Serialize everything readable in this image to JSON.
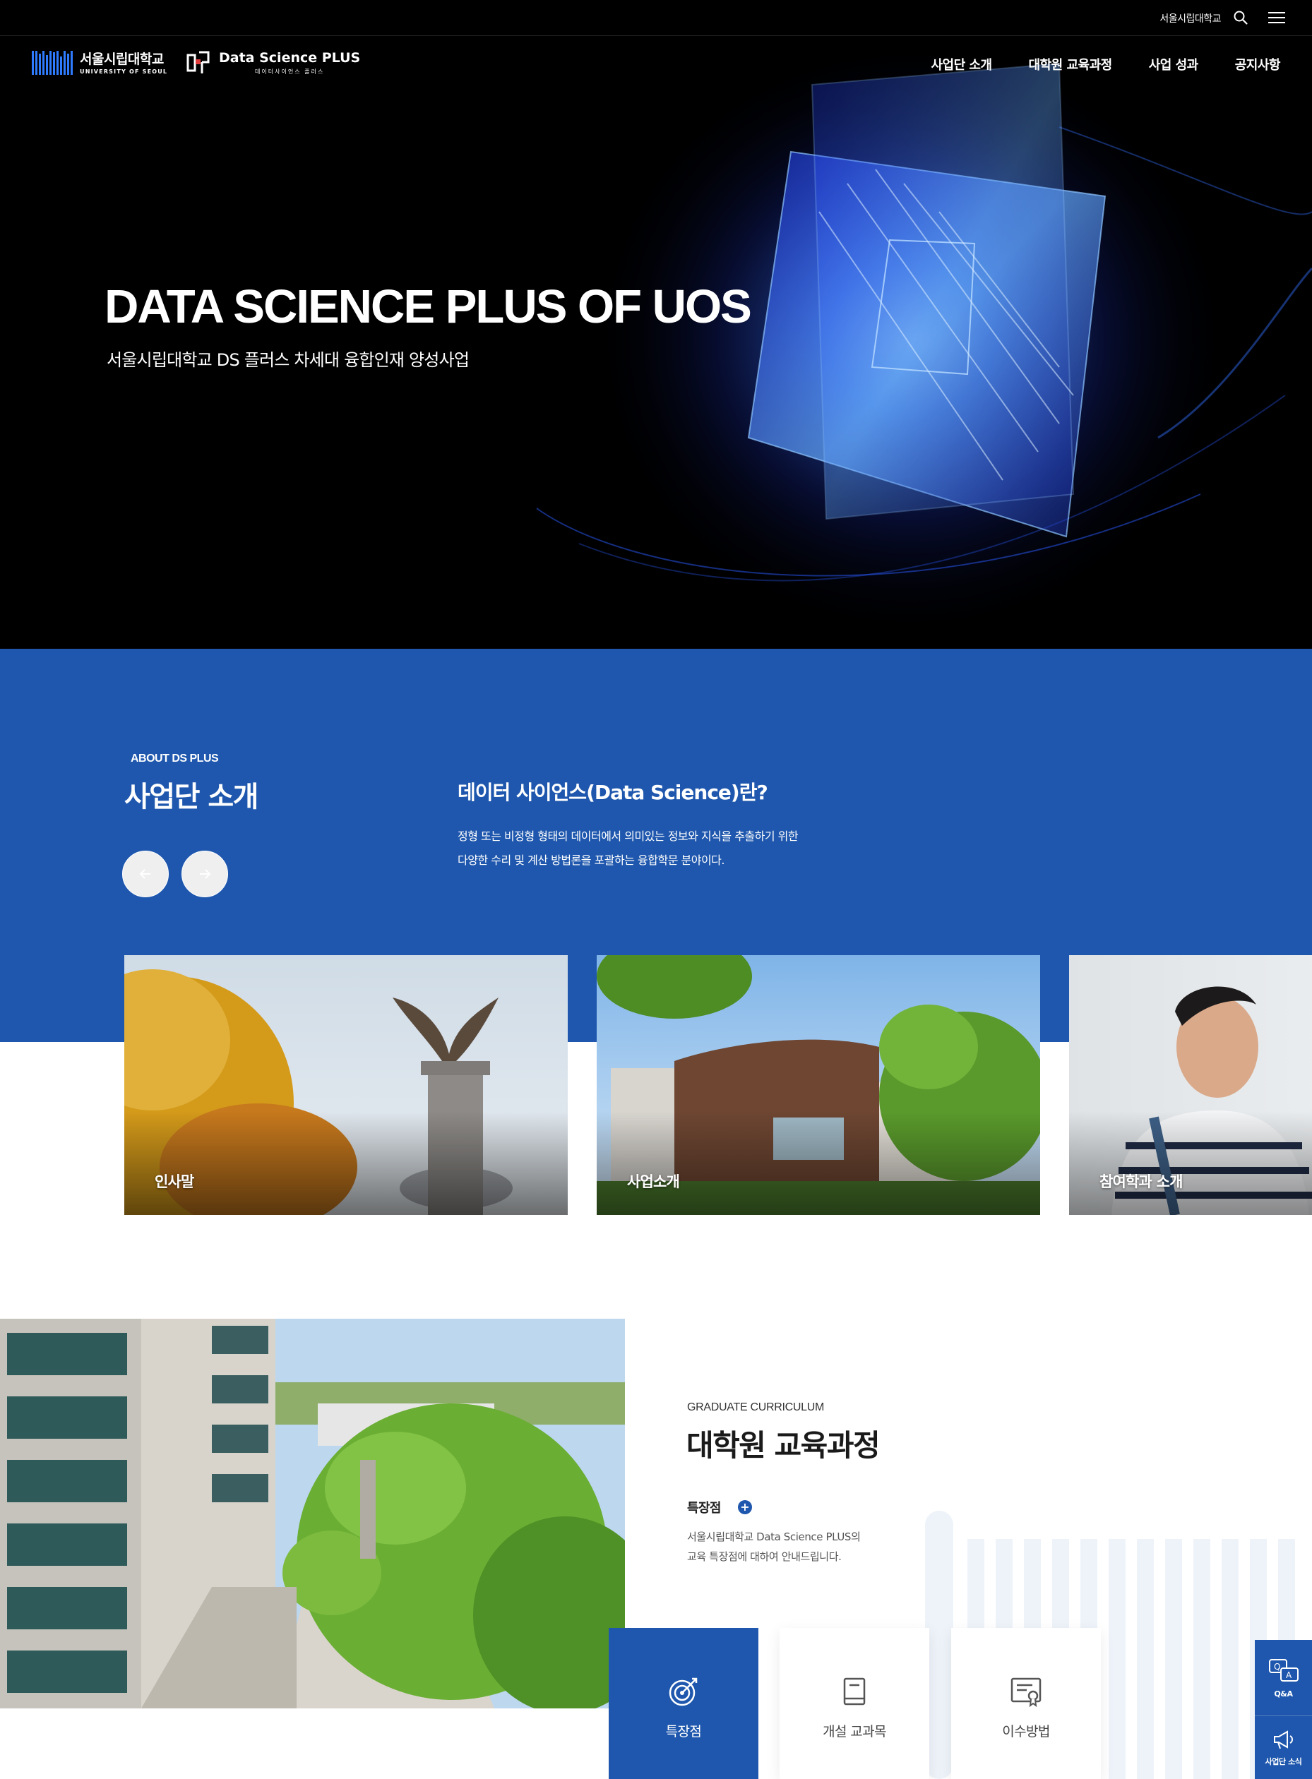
{
  "topbar": {
    "university_link": "서울시립대학교"
  },
  "logos": {
    "uos_korean": "서울시립대학교",
    "uos_english": "UNIVERSITY OF SEOUL",
    "ds_title": "Data Science PLUS",
    "ds_subtitle": "데이터사이언스 플러스"
  },
  "nav": {
    "items": [
      "사업단 소개",
      "대학원 교육과정",
      "사업 성과",
      "공지사항"
    ]
  },
  "hero": {
    "title": "DATA SCIENCE PLUS OF UOS",
    "subtitle": "서울시립대학교 DS 플러스 차세대 융합인재 양성사업"
  },
  "about": {
    "eyebrow": "ABOUT DS PLUS",
    "title": "사업단 소개",
    "heading": "데이터 사이언스(Data Science)란?",
    "body_line1": "정형 또는 비정형 형태의 데이터에서 의미있는 정보와 지식을 추출하기 위한",
    "body_line2": "다양한 수리 및 계산 방법론을 포괄하는 융합학문 분야이다.",
    "prev_icon": "arrow-left-icon",
    "next_icon": "arrow-right-icon",
    "cards": [
      "인사말",
      "사업소개",
      "참여학과 소개"
    ]
  },
  "curriculum": {
    "eyebrow": "GRADUATE CURRICULUM",
    "title": "대학원 교육과정",
    "feature_label": "특장점",
    "desc_line1": "서울시립대학교 Data Science PLUS의",
    "desc_line2": "교육 특장점에 대하여 안내드립니다.",
    "tiles": [
      {
        "label": "특장점",
        "icon": "target-icon",
        "active": true
      },
      {
        "label": "개설 교과목",
        "icon": "book-icon",
        "active": false
      },
      {
        "label": "이수방법",
        "icon": "certificate-icon",
        "active": false
      }
    ]
  },
  "quick_menu": {
    "items": [
      {
        "label": "Q&A",
        "icon": "qa-icon"
      },
      {
        "label": "사업단 소식",
        "icon": "megaphone-icon"
      }
    ]
  },
  "colors": {
    "brand_blue": "#1e57ad",
    "hero_bg": "#000000",
    "accent_light_blue": "#2f7bff"
  }
}
